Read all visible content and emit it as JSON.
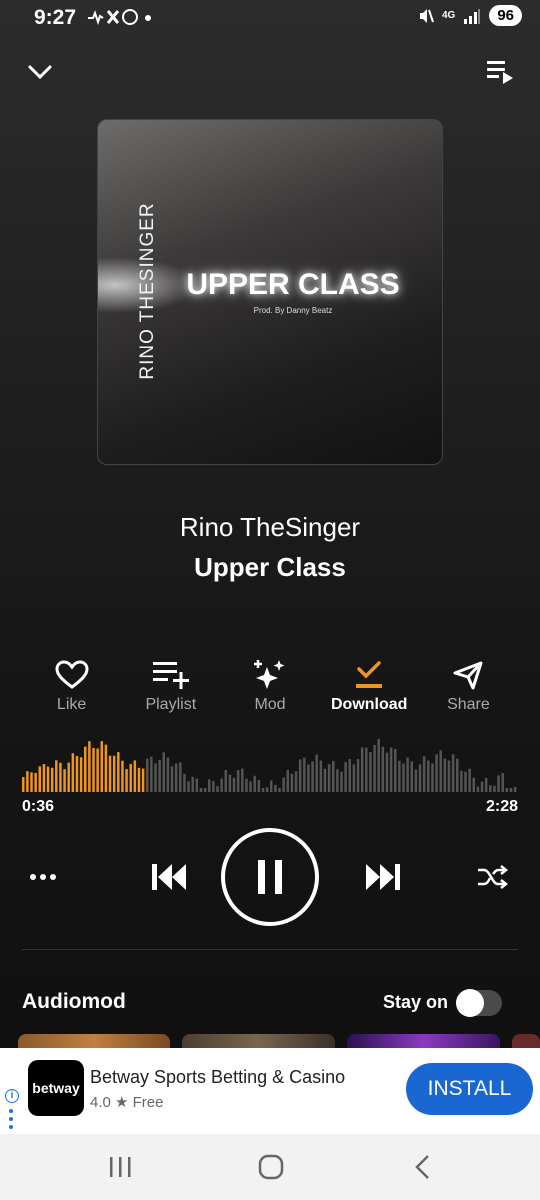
{
  "status_bar": {
    "time": "9:27",
    "left_icons": "→𝕏○ •",
    "network": "4G",
    "battery": "96"
  },
  "header": {
    "collapse_icon": "chevron-down-icon",
    "queue_icon": "queue-icon"
  },
  "album_art": {
    "artist_text": "RINO THESINGER",
    "title_text": "UPPER CLASS",
    "sub_text": "Prod. By Danny Beatz"
  },
  "track": {
    "artist": "Rino TheSinger",
    "title": "Upper Class"
  },
  "actions": [
    {
      "label": "Like",
      "icon": "heart-icon"
    },
    {
      "label": "Playlist",
      "icon": "playlist-add-icon"
    },
    {
      "label": "Mod",
      "icon": "sparkle-icon"
    },
    {
      "label": "Download",
      "icon": "download-check-icon"
    },
    {
      "label": "Share",
      "icon": "send-icon"
    }
  ],
  "playback": {
    "current_time": "0:36",
    "total_time": "2:28",
    "progress": 0.243,
    "played_color": "#f0961e",
    "unplayed_color": "#555555"
  },
  "controls": {
    "more_icon": "more-icon",
    "prev_icon": "skip-previous-icon",
    "play_icon": "pause-icon",
    "next_icon": "skip-next-icon",
    "shuffle_icon": "shuffle-icon"
  },
  "audiomod": {
    "title": "Audiomod",
    "stay_on_label": "Stay on",
    "stay_on_enabled": false
  },
  "ad": {
    "logo_text": "betway",
    "title": "Betway Sports Betting & Casino",
    "rating": "4.0 ★ Free",
    "install_label": "INSTALL"
  },
  "colors": {
    "accent": "#f0961e",
    "install_blue": "#1a67d2"
  }
}
